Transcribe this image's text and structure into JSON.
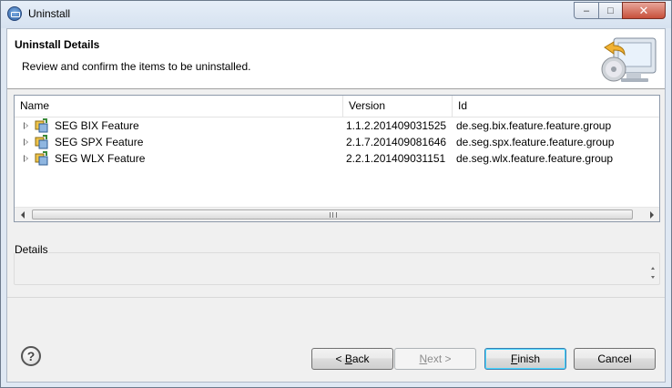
{
  "window": {
    "title": "Uninstall",
    "controls": {
      "minimize": "–",
      "maximize": "□",
      "close": "✕"
    }
  },
  "banner": {
    "title": "Uninstall Details",
    "description": "Review and confirm the items to be uninstalled."
  },
  "table": {
    "columns": [
      "Name",
      "Version",
      "Id"
    ],
    "rows": [
      {
        "name": "SEG BIX Feature",
        "version": "1.1.2.201409031525",
        "id": "de.seg.bix.feature.feature.group"
      },
      {
        "name": "SEG SPX Feature",
        "version": "2.1.7.201409081646",
        "id": "de.seg.spx.feature.feature.group"
      },
      {
        "name": "SEG WLX Feature",
        "version": "2.2.1.201409031151",
        "id": "de.seg.wlx.feature.feature.group"
      }
    ]
  },
  "details": {
    "label": "Details"
  },
  "buttons": {
    "help": "?",
    "back_prefix": "< ",
    "back_mnemonic": "B",
    "back_rest": "ack",
    "next_mnemonic": "N",
    "next_rest": "ext >",
    "finish_mnemonic": "F",
    "finish_rest": "inish",
    "cancel": "Cancel"
  },
  "colors": {
    "accent": "#3c7fb1",
    "chrome": "#dfe8f3",
    "disabled_text": "#8d8d8d"
  }
}
